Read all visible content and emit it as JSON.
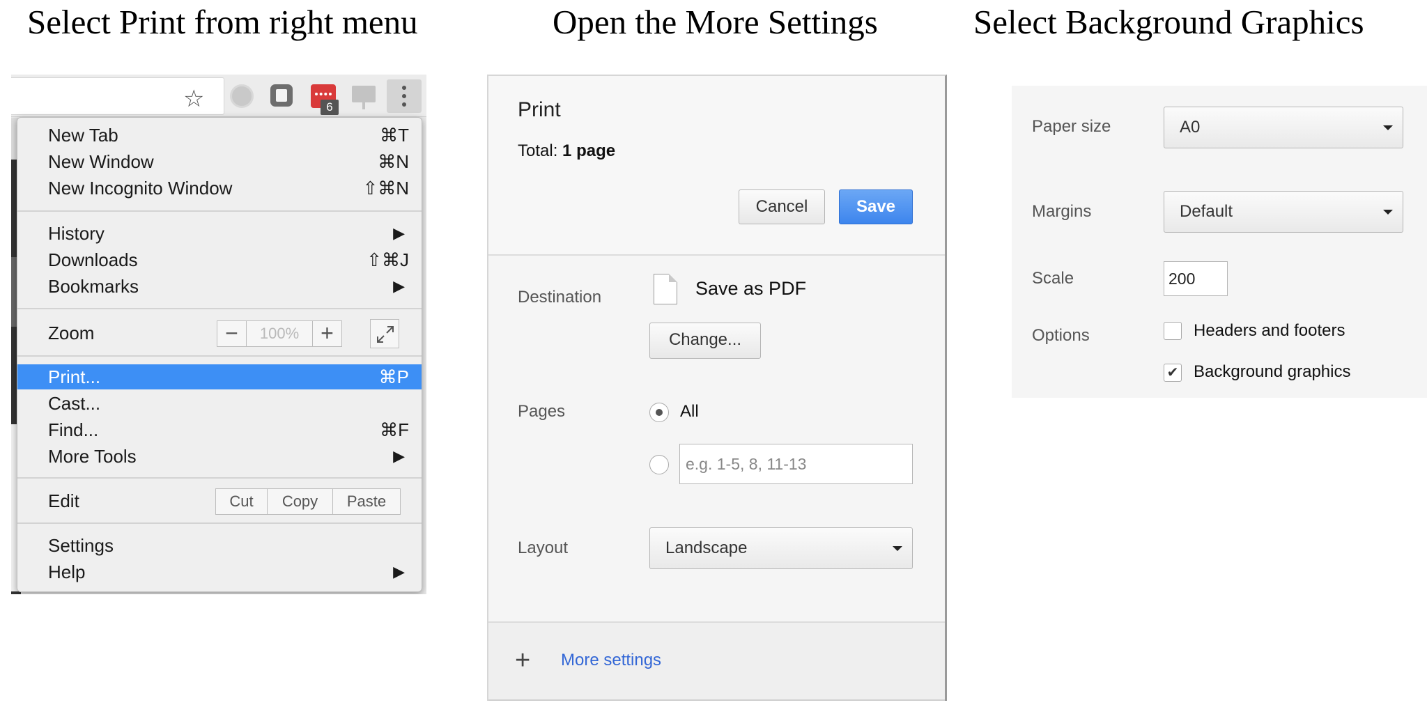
{
  "steps": [
    {
      "title": "Select Print from right menu"
    },
    {
      "title": "Open the More Settings"
    },
    {
      "title": "Select Background Graphics"
    }
  ],
  "toolbar": {
    "badge_count": "6",
    "icons": [
      "star-icon",
      "globe-extension-icon",
      "note-extension-icon",
      "calendar-extension-icon",
      "cast-screen-icon",
      "kebab-menu-icon"
    ]
  },
  "menu": {
    "new_tab": {
      "label": "New Tab",
      "shortcut": "⌘T"
    },
    "new_window": {
      "label": "New Window",
      "shortcut": "⌘N"
    },
    "incognito": {
      "label": "New Incognito Window",
      "shortcut": "⇧⌘N"
    },
    "history": {
      "label": "History",
      "arrow": "▶"
    },
    "downloads": {
      "label": "Downloads",
      "shortcut": "⇧⌘J"
    },
    "bookmarks": {
      "label": "Bookmarks",
      "arrow": "▶"
    },
    "zoom": {
      "label": "Zoom",
      "minus": "−",
      "value": "100%",
      "plus": "+"
    },
    "print": {
      "label": "Print...",
      "shortcut": "⌘P",
      "highlight": "#3d8ff5"
    },
    "cast": {
      "label": "Cast..."
    },
    "find": {
      "label": "Find...",
      "shortcut": "⌘F"
    },
    "more_tools": {
      "label": "More Tools",
      "arrow": "▶"
    },
    "edit": {
      "label": "Edit",
      "cut": "Cut",
      "copy": "Copy",
      "paste": "Paste"
    },
    "settings": {
      "label": "Settings"
    },
    "help": {
      "label": "Help",
      "arrow": "▶"
    }
  },
  "print_dialog": {
    "title": "Print",
    "total_label": "Total:",
    "total_value": "1 page",
    "cancel": "Cancel",
    "save": "Save",
    "destination_label": "Destination",
    "destination_value": "Save as PDF",
    "change": "Change...",
    "pages_label": "Pages",
    "pages_all": "All",
    "pages_all_selected": true,
    "pages_placeholder": "e.g. 1-5, 8, 11-13",
    "layout_label": "Layout",
    "layout_value": "Landscape",
    "more_plus": "+",
    "more_settings": "More settings",
    "accent_color": "#3d85ed",
    "link_color": "#3367d6"
  },
  "options_panel": {
    "paper_size_label": "Paper size",
    "paper_size_value": "A0",
    "margins_label": "Margins",
    "margins_value": "Default",
    "scale_label": "Scale",
    "scale_value": "200",
    "options_label": "Options",
    "headers_footers": {
      "label": "Headers and footers",
      "checked": false
    },
    "background_graphics": {
      "label": "Background graphics",
      "checked": true,
      "mark": "✔"
    }
  }
}
